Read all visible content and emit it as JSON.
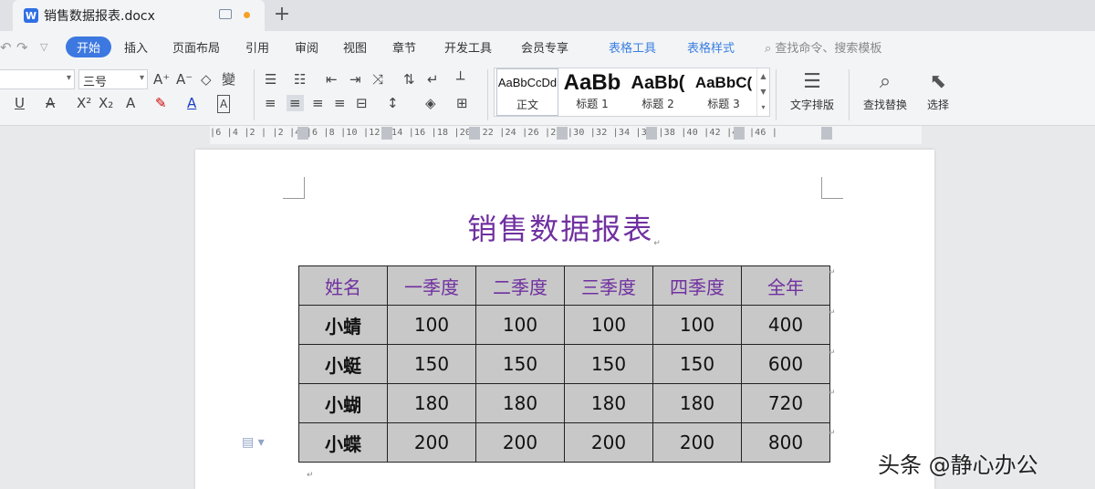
{
  "tab": {
    "title": "销售数据报表.docx",
    "app_icon": "W"
  },
  "menu": {
    "items": [
      "开始",
      "插入",
      "页面布局",
      "引用",
      "审阅",
      "视图",
      "章节",
      "开发工具",
      "会员专享",
      "表格工具",
      "表格样式"
    ],
    "search_placeholder": "查找命令、搜索模板"
  },
  "ribbon": {
    "font_size": "三号",
    "styles": [
      {
        "sample": "AaBbCcDd",
        "name": "正文"
      },
      {
        "sample": "AaBb",
        "name": "标题 1"
      },
      {
        "sample": "AaBb(",
        "name": "标题 2"
      },
      {
        "sample": "AaBbC(",
        "name": "标题 3"
      }
    ],
    "text_layout": "文字排版",
    "find_replace": "查找替换",
    "select": "选择"
  },
  "ruler": {
    "numbers": "|6  |4  |2  |    |2  |4  |6  |8  |10 |12 |14 |16 |18 |20 |22 |24 |26 |28 |30 |32 |34 |36 |38 |40 |42 |44 |46 |"
  },
  "document": {
    "heading": "销售数据报表",
    "table": {
      "headers": [
        "姓名",
        "一季度",
        "二季度",
        "三季度",
        "四季度",
        "全年"
      ],
      "rows": [
        [
          "小蜻",
          "100",
          "100",
          "100",
          "100",
          "400"
        ],
        [
          "小蜓",
          "150",
          "150",
          "150",
          "150",
          "600"
        ],
        [
          "小蝴",
          "180",
          "180",
          "180",
          "180",
          "720"
        ],
        [
          "小蝶",
          "200",
          "200",
          "200",
          "200",
          "800"
        ]
      ]
    }
  },
  "watermark": "头条 @静心办公",
  "colors": {
    "heading": "#7030a0",
    "cell_bg": "#c8c8c8",
    "accent": "#3c78e0"
  }
}
